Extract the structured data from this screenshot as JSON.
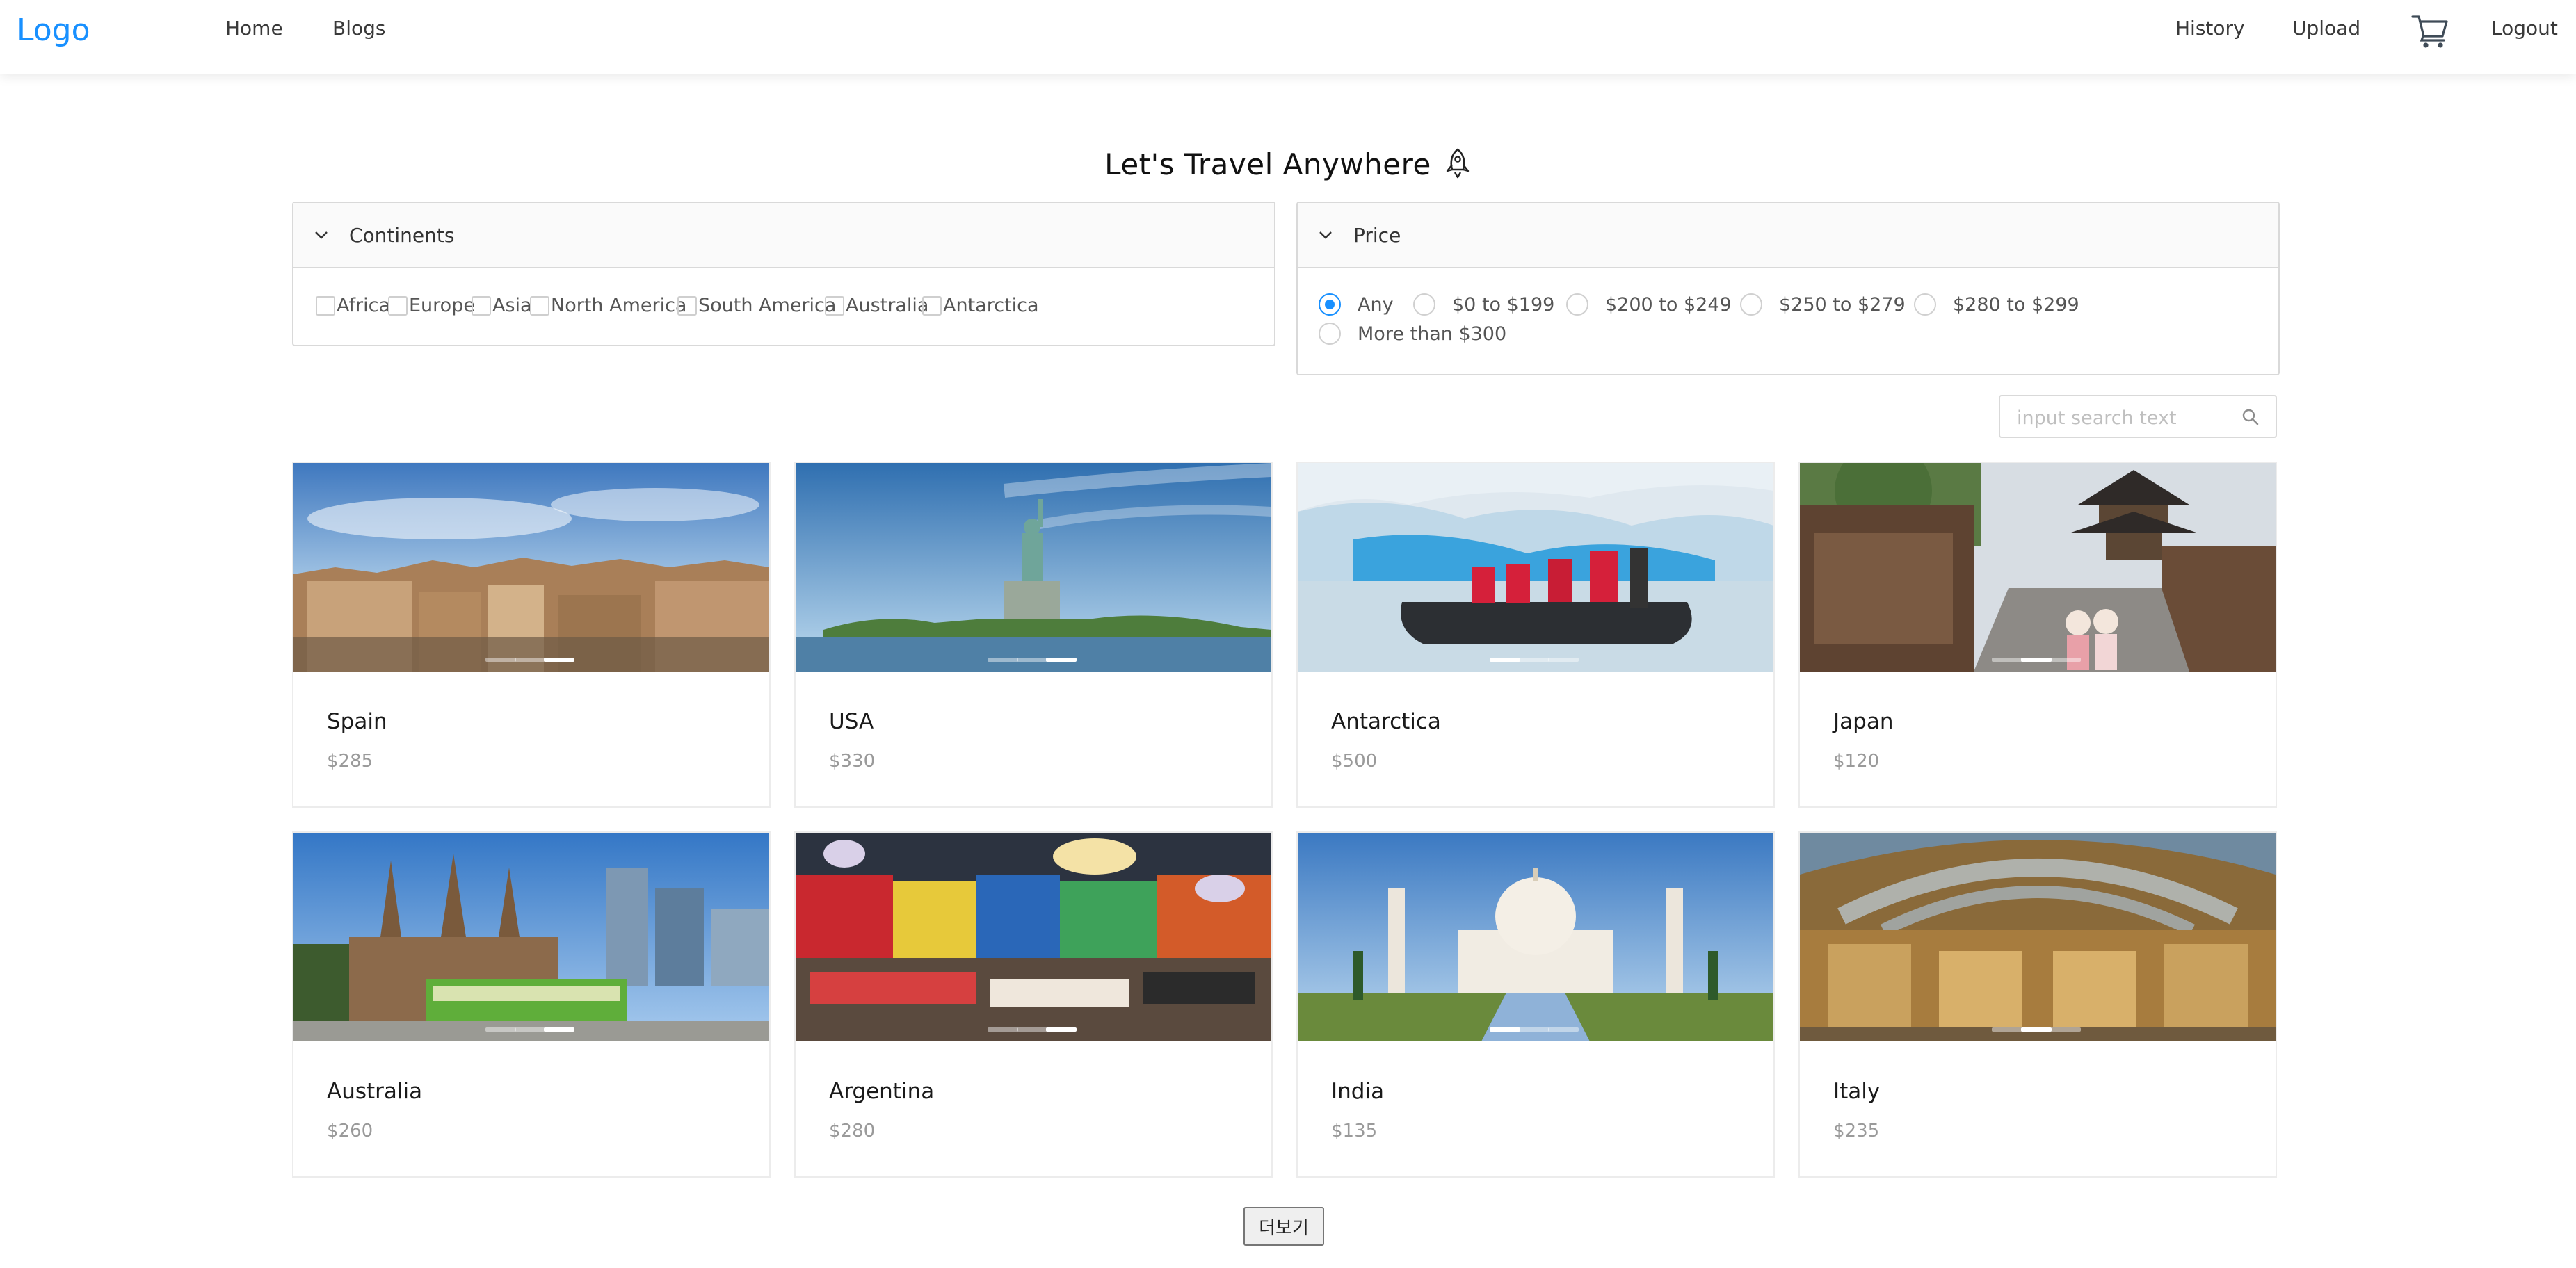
{
  "nav": {
    "logo": "Logo",
    "home": "Home",
    "blogs": "Blogs",
    "history": "History",
    "upload": "Upload",
    "cart_icon": "cart-icon",
    "logout": "Logout"
  },
  "heading": {
    "text": "Let's Travel Anywhere",
    "icon": "rocket-icon"
  },
  "continents": {
    "title": "Continents",
    "options": [
      "Africa",
      "Europe",
      "Asia",
      "North America",
      "South America",
      "Australia",
      "Antarctica"
    ]
  },
  "price": {
    "title": "Price",
    "selected": "Any",
    "options": [
      "Any",
      "$0 to $199",
      "$200 to $249",
      "$250 to $279",
      "$280 to $299",
      "More than $300"
    ]
  },
  "search": {
    "placeholder": "input search text",
    "icon": "search-icon"
  },
  "products": [
    {
      "name": "Spain",
      "price": "$285",
      "image": "madrid-city-panorama"
    },
    {
      "name": "USA",
      "price": "$330",
      "image": "statue-of-liberty"
    },
    {
      "name": "Antarctica",
      "price": "$500",
      "image": "zodiac-boat-iceberg"
    },
    {
      "name": "Japan",
      "price": "$120",
      "image": "kyoto-street-pagoda"
    },
    {
      "name": "Australia",
      "price": "$260",
      "image": "melbourne-cathedral-tram"
    },
    {
      "name": "Argentina",
      "price": "$280",
      "image": "colorful-restaurant-interior"
    },
    {
      "name": "India",
      "price": "$135",
      "image": "taj-mahal"
    },
    {
      "name": "Italy",
      "price": "$235",
      "image": "milan-galleria"
    }
  ],
  "load_more": "더보기",
  "colors": {
    "accent": "#1890ff",
    "border": "#d9d9d9"
  }
}
